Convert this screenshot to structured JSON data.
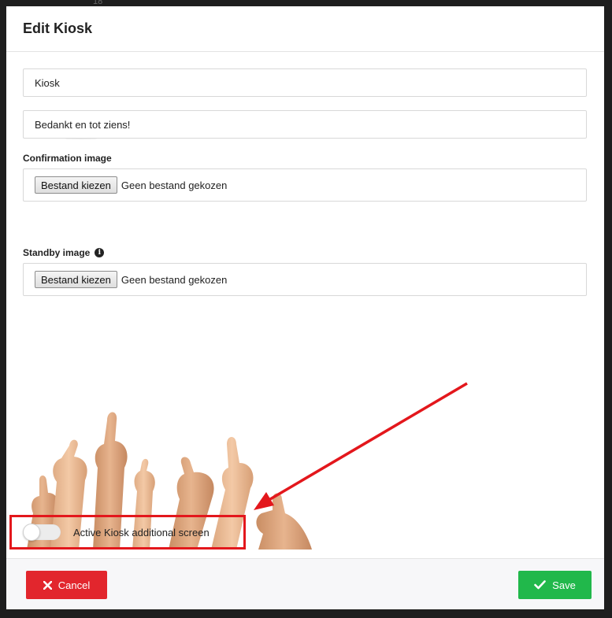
{
  "background": {
    "fragment_text": "18"
  },
  "modal": {
    "title": "Edit Kiosk",
    "fields": {
      "kiosk_name": {
        "value": "Kiosk"
      },
      "message": {
        "value": "Bedankt en tot ziens!"
      }
    },
    "confirmation_image": {
      "label": "Confirmation image",
      "button_label": "Bestand kiezen",
      "status": "Geen bestand gekozen"
    },
    "standby_image": {
      "label": "Standby image",
      "button_label": "Bestand kiezen",
      "status": "Geen bestand gekozen",
      "info_icon": "info-icon"
    },
    "additional_screen": {
      "label": "Active Kiosk additional screen",
      "enabled": false
    }
  },
  "footer": {
    "cancel": {
      "label": "Cancel",
      "icon": "close-icon",
      "color": "#e2262d"
    },
    "save": {
      "label": "Save",
      "icon": "checkmark-icon",
      "color": "#21b84b"
    }
  },
  "annotation": {
    "highlight_color": "#e3171c"
  }
}
